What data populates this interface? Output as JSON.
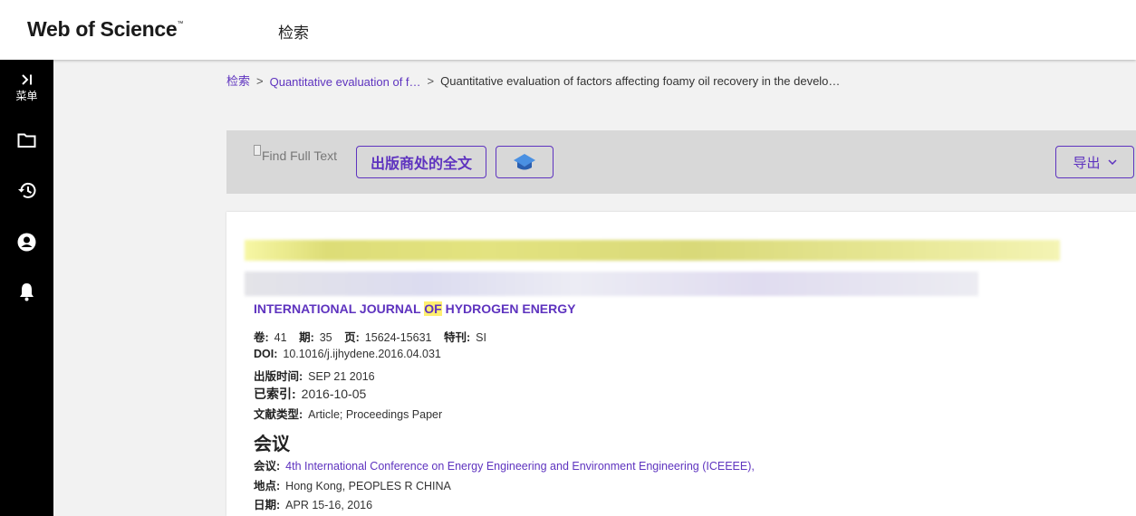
{
  "header": {
    "logo": "Web of Science",
    "logo_tm": "™",
    "nav_search": "检索"
  },
  "sidebar": {
    "menu_label": "菜单",
    "icons": [
      "expand-icon",
      "folder-icon",
      "history-icon",
      "account-icon",
      "bell-icon"
    ]
  },
  "breadcrumb": {
    "items": [
      "检索",
      "Quantitative evaluation of f…",
      "Quantitative evaluation of factors affecting foamy oil recovery in the develo…"
    ],
    "separator": ">"
  },
  "toolbar": {
    "find_full_text": "Find Full Text",
    "publisher_full_text": "出版商处的全文",
    "export_label": "导出"
  },
  "record": {
    "journal_pre": "INTERNATIONAL JOURNAL ",
    "journal_hl": "OF",
    "journal_post": " HYDROGEN ENERGY",
    "volume_label": "卷:",
    "volume": "41",
    "issue_label": "期:",
    "issue": "35",
    "pages_label": "页:",
    "pages": "15624-15631",
    "special_label": "特刊:",
    "special": "SI",
    "doi_label": "DOI:",
    "doi": "10.1016/j.ijhydene.2016.04.031",
    "pub_date_label": "出版时间:",
    "pub_date": "SEP 21 2016",
    "indexed_label": "已索引:",
    "indexed": "2016-10-05",
    "doc_type_label": "文献类型:",
    "doc_type": "Article; Proceedings Paper"
  },
  "conference": {
    "heading": "会议",
    "name_label": "会议:",
    "name": "4th International Conference on Energy Engineering and Environment Engineering (ICEEEE),",
    "location_label": "地点:",
    "location": "Hong Kong, PEOPLES R CHINA",
    "date_label": "日期:",
    "date": "APR 15-16, 2016"
  },
  "colors": {
    "accent": "#5e33bf",
    "sidebar": "#000000",
    "highlight": "#ffef70"
  }
}
